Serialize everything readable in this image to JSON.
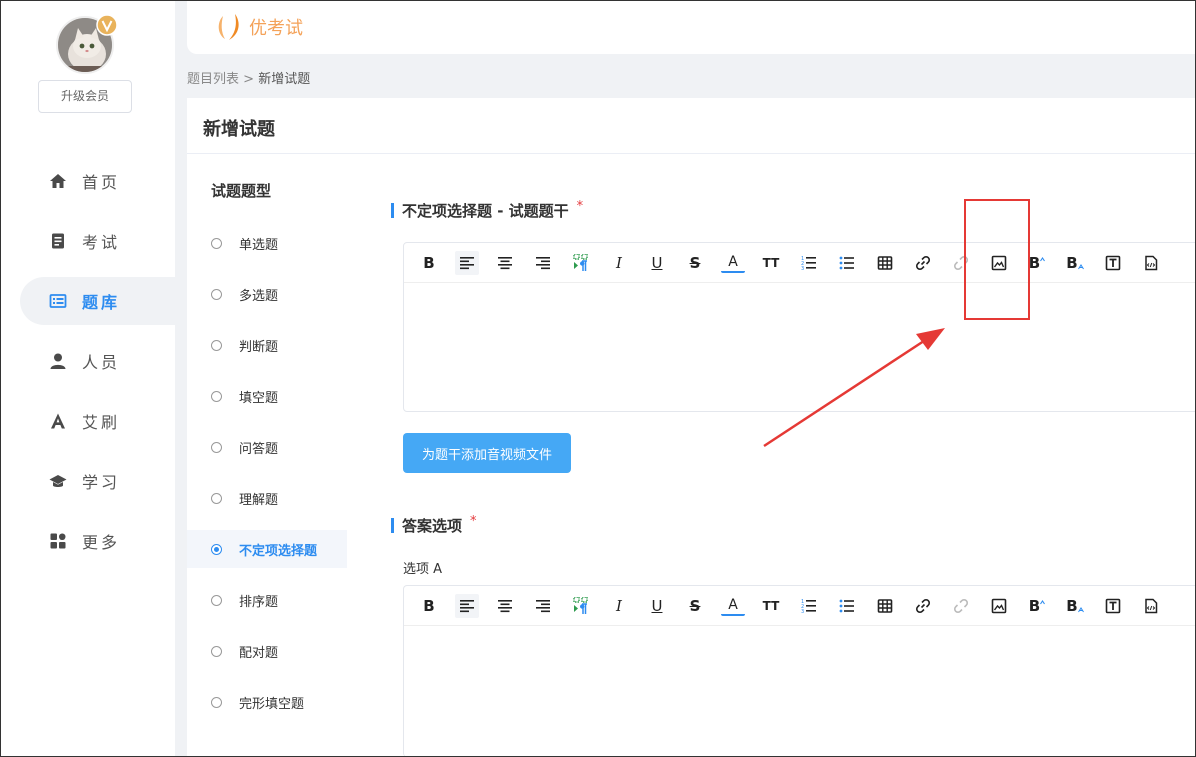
{
  "sidebar": {
    "upgrade_label": "升级会员",
    "items": [
      {
        "label": "首页",
        "icon": "home-icon"
      },
      {
        "label": "考试",
        "icon": "exam-icon"
      },
      {
        "label": "题库",
        "icon": "question-bank-icon",
        "active": true
      },
      {
        "label": "人员",
        "icon": "user-icon"
      },
      {
        "label": "艾刷",
        "icon": "practice-icon"
      },
      {
        "label": "学习",
        "icon": "graduation-cap-icon"
      },
      {
        "label": "更多",
        "icon": "grid-icon"
      }
    ]
  },
  "header": {
    "logo_text": "优考试"
  },
  "breadcrumb": {
    "parent": "题目列表",
    "separator": " > ",
    "current": "新增试题"
  },
  "page": {
    "title": "新增试题"
  },
  "question_types": {
    "heading": "试题题型",
    "items": [
      "单选题",
      "多选题",
      "判断题",
      "填空题",
      "问答题",
      "理解题",
      "不定项选择题",
      "排序题",
      "配对题",
      "完形填空题"
    ],
    "selected": "不定项选择题"
  },
  "stem": {
    "title": "不定项选择题 - 试题题干",
    "required_mark": "*",
    "add_media_label": "为题干添加音视频文件"
  },
  "answers": {
    "title": "答案选项",
    "required_mark": "*",
    "option_a_label": "选项 A"
  },
  "toolbar_glyphs": {
    "bold": "B",
    "italic": "I",
    "underline": "U",
    "strike": "S",
    "font_color": "A",
    "font_size": "TT",
    "superscript_base": "B",
    "subscript_base": "B",
    "text_box": "T"
  },
  "colors": {
    "accent": "#2d8cf0",
    "button": "#45a8f5",
    "required": "#e4393c",
    "highlight": "#e53935",
    "logo": "#f4a259"
  }
}
